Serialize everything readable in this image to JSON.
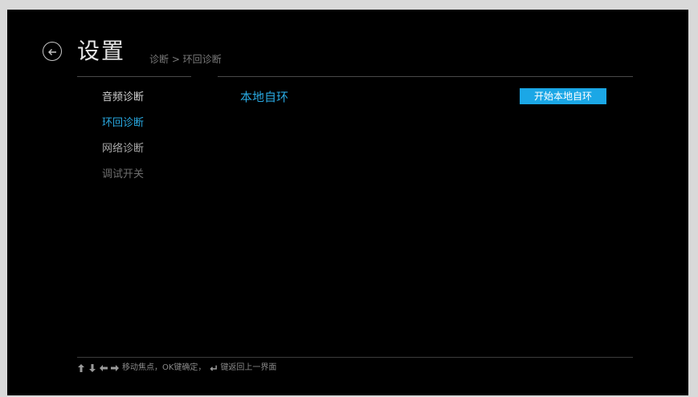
{
  "header": {
    "title": "设置",
    "breadcrumb": "诊断 > 环回诊断"
  },
  "sidebar": {
    "items": [
      {
        "label": "音频诊断",
        "state": "normal"
      },
      {
        "label": "环回诊断",
        "state": "selected"
      },
      {
        "label": "网络诊断",
        "state": "normal"
      },
      {
        "label": "调试开关",
        "state": "disabled"
      }
    ]
  },
  "main": {
    "title": "本地自环",
    "start_button_label": "开始本地自环"
  },
  "footer": {
    "hint_part1": "移动焦点，OK键确定，",
    "hint_part2": "键返回上一界面"
  },
  "colors": {
    "accent": "#1ba7e6",
    "selected_text": "#29a8e0",
    "normal_text": "#d0d0d0",
    "disabled_text": "#6e6e6e"
  },
  "icons": {
    "back": "circle-arrow-left-icon",
    "up": "arrow-up-icon",
    "down": "arrow-down-icon",
    "left": "arrow-left-icon",
    "right": "arrow-right-icon",
    "return": "return-icon"
  }
}
